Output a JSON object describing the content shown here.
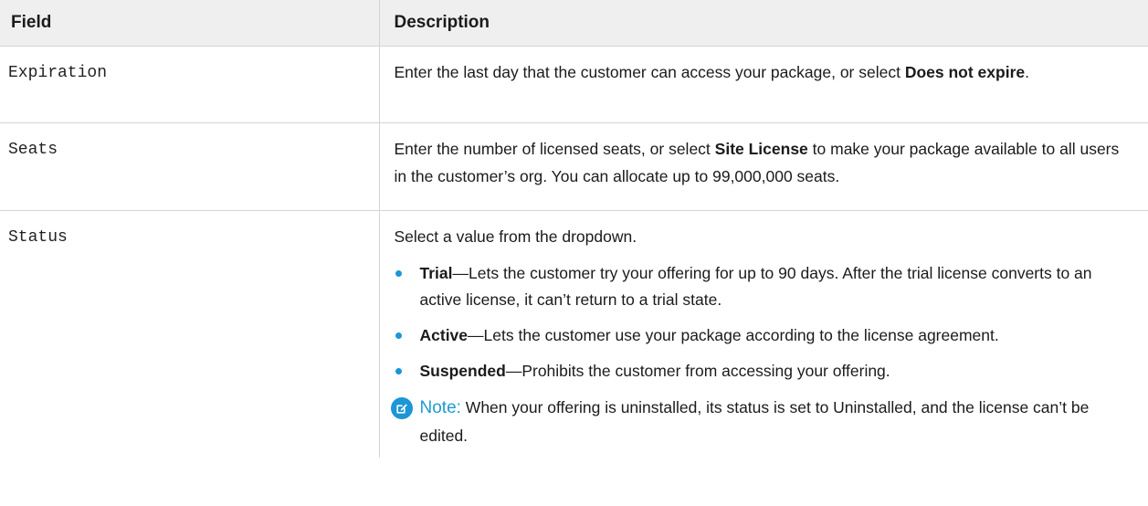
{
  "table": {
    "headers": {
      "field": "Field",
      "description": "Description"
    },
    "rows": [
      {
        "field": "Expiration",
        "desc": {
          "before": "Enter the last day that the customer can access your package, or select ",
          "bold": "Does not expire",
          "after": "."
        }
      },
      {
        "field": "Seats",
        "desc": {
          "before": "Enter the number of licensed seats, or select ",
          "bold": "Site License",
          "after": " to make your package available to all users in the customer’s org. You can allocate up to 99,000,000 seats."
        }
      },
      {
        "field": "Status",
        "desc": {
          "intro": "Select a value from the dropdown.",
          "bullets": [
            {
              "term": "Trial",
              "text": "—Lets the customer try your offering for up to 90 days. After the trial license converts to an active license, it can’t return to a trial state."
            },
            {
              "term": "Active",
              "text": "—Lets the customer use your package according to the license agreement."
            },
            {
              "term": "Suspended",
              "text": "—Prohibits the customer from accessing your offering."
            }
          ],
          "note": {
            "icon": "note-edit-icon",
            "label": "Note:",
            "text": "When your offering is uninstalled, its status is set to Uninstalled, and the license can’t be edited."
          }
        }
      }
    ]
  },
  "colors": {
    "header_bg": "#efefef",
    "border": "#d4d4d4",
    "accent": "#1b96d6",
    "text": "#1b1b1b"
  }
}
